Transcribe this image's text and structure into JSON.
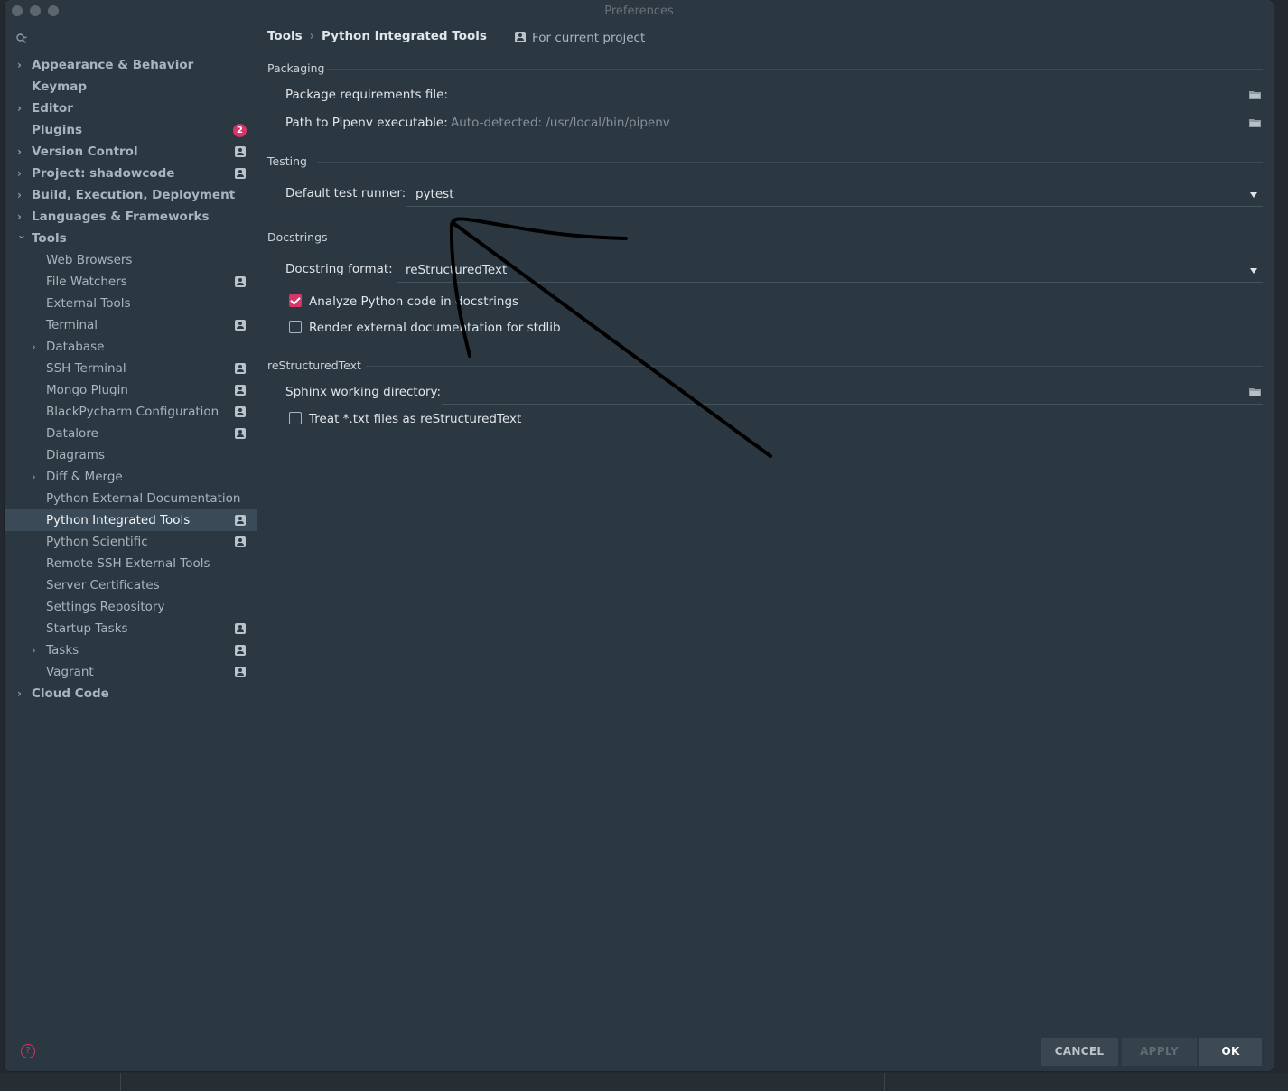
{
  "window": {
    "title": "Preferences"
  },
  "sidebar": {
    "items": [
      {
        "label": "Appearance & Behavior",
        "level": 0,
        "expandable": true,
        "expanded": false,
        "project_icon": false
      },
      {
        "label": "Keymap",
        "level": 0,
        "expandable": false,
        "project_icon": false
      },
      {
        "label": "Editor",
        "level": 0,
        "expandable": true,
        "expanded": false,
        "project_icon": false
      },
      {
        "label": "Plugins",
        "level": 0,
        "expandable": false,
        "badge": "2"
      },
      {
        "label": "Version Control",
        "level": 0,
        "expandable": true,
        "expanded": false,
        "project_icon": true
      },
      {
        "label": "Project: shadowcode",
        "level": 0,
        "expandable": true,
        "expanded": false,
        "project_icon": true
      },
      {
        "label": "Build, Execution, Deployment",
        "level": 0,
        "expandable": true,
        "expanded": false,
        "project_icon": false
      },
      {
        "label": "Languages & Frameworks",
        "level": 0,
        "expandable": true,
        "expanded": false,
        "project_icon": false
      },
      {
        "label": "Tools",
        "level": 0,
        "expandable": true,
        "expanded": true,
        "project_icon": false
      },
      {
        "label": "Web Browsers",
        "level": 1,
        "expandable": false,
        "project_icon": false
      },
      {
        "label": "File Watchers",
        "level": 1,
        "expandable": false,
        "project_icon": true
      },
      {
        "label": "External Tools",
        "level": 1,
        "expandable": false,
        "project_icon": false
      },
      {
        "label": "Terminal",
        "level": 1,
        "expandable": false,
        "project_icon": true
      },
      {
        "label": "Database",
        "level": 1,
        "expandable": true,
        "expanded": false,
        "project_icon": false
      },
      {
        "label": "SSH Terminal",
        "level": 1,
        "expandable": false,
        "project_icon": true
      },
      {
        "label": "Mongo Plugin",
        "level": 1,
        "expandable": false,
        "project_icon": true
      },
      {
        "label": "BlackPycharm Configuration",
        "level": 1,
        "expandable": false,
        "project_icon": true
      },
      {
        "label": "Datalore",
        "level": 1,
        "expandable": false,
        "project_icon": true
      },
      {
        "label": "Diagrams",
        "level": 1,
        "expandable": false,
        "project_icon": false
      },
      {
        "label": "Diff & Merge",
        "level": 1,
        "expandable": true,
        "expanded": false,
        "project_icon": false
      },
      {
        "label": "Python External Documentation",
        "level": 1,
        "expandable": false,
        "project_icon": false
      },
      {
        "label": "Python Integrated Tools",
        "level": 1,
        "expandable": false,
        "project_icon": true,
        "selected": true
      },
      {
        "label": "Python Scientific",
        "level": 1,
        "expandable": false,
        "project_icon": true
      },
      {
        "label": "Remote SSH External Tools",
        "level": 1,
        "expandable": false,
        "project_icon": false
      },
      {
        "label": "Server Certificates",
        "level": 1,
        "expandable": false,
        "project_icon": false
      },
      {
        "label": "Settings Repository",
        "level": 1,
        "expandable": false,
        "project_icon": false
      },
      {
        "label": "Startup Tasks",
        "level": 1,
        "expandable": false,
        "project_icon": true
      },
      {
        "label": "Tasks",
        "level": 1,
        "expandable": true,
        "expanded": false,
        "project_icon": true
      },
      {
        "label": "Vagrant",
        "level": 1,
        "expandable": false,
        "project_icon": true
      },
      {
        "label": "Cloud Code",
        "level": 0,
        "expandable": true,
        "expanded": false,
        "project_icon": false
      }
    ]
  },
  "breadcrumb": {
    "parent": "Tools",
    "separator": "›",
    "current": "Python Integrated Tools"
  },
  "scope": {
    "label": "For current project"
  },
  "packaging": {
    "title": "Packaging",
    "requirements_label": "Package requirements file:",
    "requirements_value": "",
    "pipenv_label": "Path to Pipenv executable:",
    "pipenv_placeholder": "Auto-detected: /usr/local/bin/pipenv"
  },
  "testing": {
    "title": "Testing",
    "runner_label": "Default test runner:",
    "runner_value": "pytest"
  },
  "docstrings": {
    "title": "Docstrings",
    "format_label": "Docstring format:",
    "format_value": "reStructuredText",
    "analyze_label": "Analyze Python code in docstrings",
    "analyze_checked": true,
    "render_label": "Render external documentation for stdlib",
    "render_checked": false
  },
  "rest": {
    "title": "reStructuredText",
    "sphinx_label": "Sphinx working directory:",
    "sphinx_value": "",
    "treat_txt_label": "Treat *.txt files as reStructuredText",
    "treat_txt_checked": false
  },
  "footer": {
    "help_icon": "?",
    "cancel": "CANCEL",
    "apply": "APPLY",
    "ok": "OK"
  },
  "colors": {
    "accent": "#d7356a",
    "background": "#2c3841",
    "selected": "#3a4a56"
  }
}
